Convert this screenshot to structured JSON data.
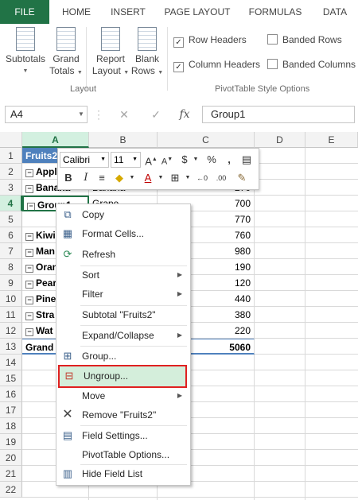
{
  "tabs": [
    "FILE",
    "HOME",
    "INSERT",
    "PAGE LAYOUT",
    "FORMULAS",
    "DATA"
  ],
  "ribbon": {
    "buttons": [
      {
        "line1": "Subtotals",
        "line2": ""
      },
      {
        "line1": "Grand",
        "line2": "Totals"
      },
      {
        "line1": "Report",
        "line2": "Layout"
      },
      {
        "line1": "Blank",
        "line2": "Rows"
      }
    ],
    "layout_group_label": "Layout",
    "style_options_label": "PivotTable Style Options",
    "checkboxes": [
      {
        "label": "Row Headers",
        "checked": true
      },
      {
        "label": "Banded Rows",
        "checked": false
      },
      {
        "label": "Column Headers",
        "checked": true
      },
      {
        "label": "Banded Columns",
        "checked": false
      }
    ]
  },
  "formula_bar": {
    "name_box": "A4",
    "fx": "fx",
    "formula": "Group1"
  },
  "grid": {
    "columns": [
      "A",
      "B",
      "C",
      "D",
      "E"
    ],
    "selected_column": "A",
    "rows": [
      "1",
      "2",
      "3",
      "4",
      "5",
      "6",
      "7",
      "8",
      "9",
      "10",
      "11",
      "12",
      "13",
      "14",
      "15",
      "16",
      "17",
      "18",
      "19",
      "20",
      "21",
      "22"
    ],
    "selected_row": "4",
    "cells": {
      "a1": "Fruits2",
      "a2": "Appl",
      "a3": "Banana",
      "b3": "Banana",
      "c3": "270",
      "a4": "Group1",
      "b4": "Grape",
      "c4": "700",
      "c5": "770",
      "a6": "Kiwi",
      "c6": "760",
      "a7": "Man",
      "c7": "980",
      "a8": "Oran",
      "c8": "190",
      "a9": "Pear",
      "c9": "120",
      "a10": "Pine",
      "c10": "440",
      "a11": "Stra",
      "c11": "380",
      "a12": "Wat",
      "c12": "220",
      "a13": "Grand",
      "c13": "5060"
    }
  },
  "mini_toolbar": {
    "font": "Calibri",
    "size": "11",
    "bold": "B",
    "italic": "I",
    "percent": "%",
    "comma": ",",
    "currency": "$"
  },
  "context_menu": {
    "items": [
      {
        "label": "Copy",
        "icon": "copy-icon"
      },
      {
        "label": "Format Cells...",
        "icon": "format-cells-icon"
      },
      {
        "label": "Refresh",
        "icon": "refresh-icon"
      },
      {
        "label": "Sort",
        "submenu": true
      },
      {
        "label": "Filter",
        "submenu": true
      },
      {
        "label": "Subtotal \"Fruits2\""
      },
      {
        "label": "Expand/Collapse",
        "submenu": true
      },
      {
        "label": "Group...",
        "icon": "group-icon"
      },
      {
        "label": "Ungroup...",
        "icon": "ungroup-icon",
        "highlighted": true
      },
      {
        "label": "Move",
        "submenu": true
      },
      {
        "label": "Remove \"Fruits2\"",
        "icon": "remove-icon"
      },
      {
        "label": "Field Settings...",
        "icon": "field-settings-icon"
      },
      {
        "label": "PivotTable Options..."
      },
      {
        "label": "Hide Field List",
        "icon": "field-list-icon"
      }
    ]
  },
  "colors": {
    "excel_green": "#217346",
    "highlight_fill": "#d4eedb",
    "highlight_border": "#e02020",
    "pivot_header_fill": "#4f81bd",
    "pivot_row_band": "#dce6f1"
  }
}
